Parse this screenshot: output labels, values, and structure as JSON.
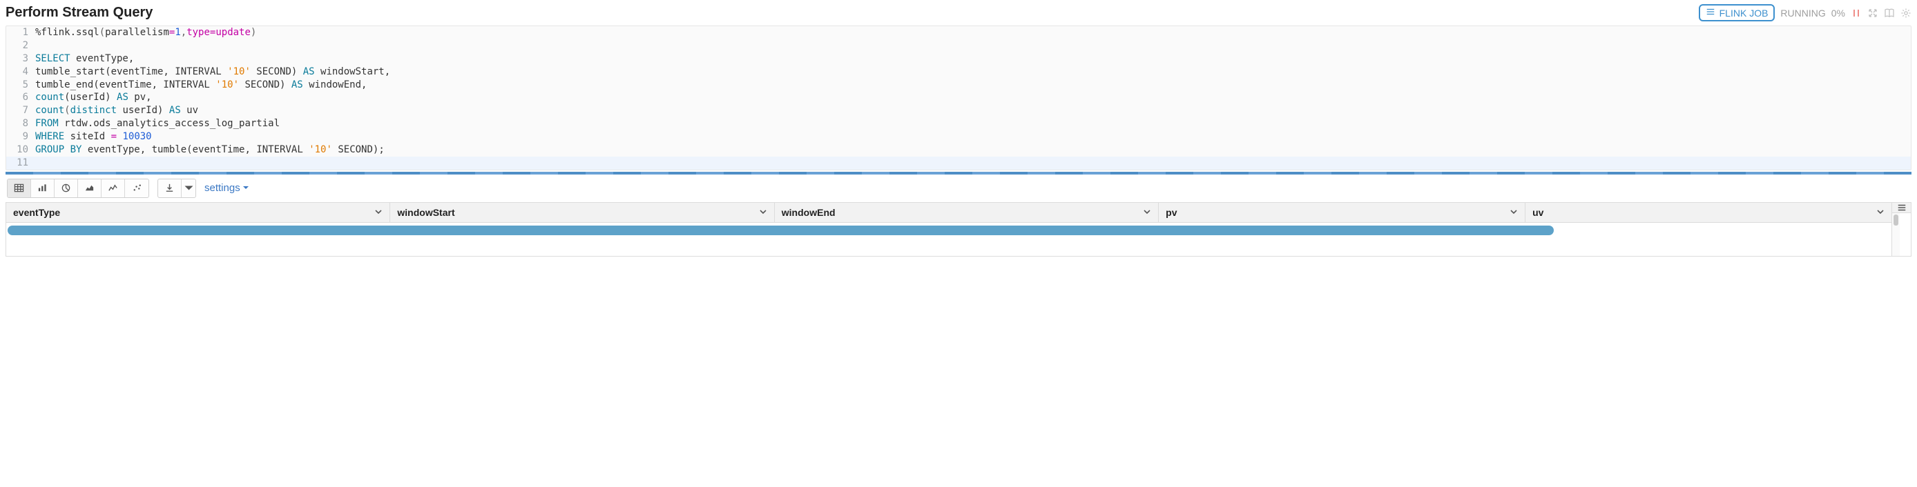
{
  "header": {
    "title": "Perform Stream Query",
    "flink_job_label": "FLINK JOB",
    "status": "RUNNING",
    "progress": "0%"
  },
  "code": {
    "lines": [
      {
        "n": "1",
        "tokens": [
          {
            "t": "%flink.ssql",
            "c": "tk-id"
          },
          {
            "t": "(",
            "c": "tk-punc"
          },
          {
            "t": "parallelism",
            "c": "tk-id"
          },
          {
            "t": "=",
            "c": "tk-op"
          },
          {
            "t": "1",
            "c": "tk-num"
          },
          {
            "t": ",",
            "c": "tk-punc"
          },
          {
            "t": "type",
            "c": "tk-type"
          },
          {
            "t": "=",
            "c": "tk-op"
          },
          {
            "t": "update",
            "c": "tk-type"
          },
          {
            "t": ")",
            "c": "tk-punc"
          }
        ]
      },
      {
        "n": "2",
        "tokens": []
      },
      {
        "n": "3",
        "tokens": [
          {
            "t": "SELECT",
            "c": "tk-key"
          },
          {
            "t": " eventType,",
            "c": "tk-id"
          }
        ]
      },
      {
        "n": "4",
        "tokens": [
          {
            "t": "tumble_start(eventTime, INTERVAL ",
            "c": "tk-id"
          },
          {
            "t": "'10'",
            "c": "tk-str"
          },
          {
            "t": " SECOND) ",
            "c": "tk-id"
          },
          {
            "t": "AS",
            "c": "tk-key"
          },
          {
            "t": " windowStart,",
            "c": "tk-id"
          }
        ]
      },
      {
        "n": "5",
        "tokens": [
          {
            "t": "tumble_end(eventTime, INTERVAL ",
            "c": "tk-id"
          },
          {
            "t": "'10'",
            "c": "tk-str"
          },
          {
            "t": " SECOND) ",
            "c": "tk-id"
          },
          {
            "t": "AS",
            "c": "tk-key"
          },
          {
            "t": " windowEnd,",
            "c": "tk-id"
          }
        ]
      },
      {
        "n": "6",
        "tokens": [
          {
            "t": "count",
            "c": "tk-key"
          },
          {
            "t": "(userId) ",
            "c": "tk-id"
          },
          {
            "t": "AS",
            "c": "tk-key"
          },
          {
            "t": " pv,",
            "c": "tk-id"
          }
        ]
      },
      {
        "n": "7",
        "tokens": [
          {
            "t": "count",
            "c": "tk-key"
          },
          {
            "t": "(",
            "c": "tk-punc"
          },
          {
            "t": "distinct",
            "c": "tk-key"
          },
          {
            "t": " userId) ",
            "c": "tk-id"
          },
          {
            "t": "AS",
            "c": "tk-key"
          },
          {
            "t": " uv",
            "c": "tk-id"
          }
        ]
      },
      {
        "n": "8",
        "tokens": [
          {
            "t": "FROM",
            "c": "tk-key"
          },
          {
            "t": " rtdw.ods_analytics_access_log_partial",
            "c": "tk-id"
          }
        ]
      },
      {
        "n": "9",
        "tokens": [
          {
            "t": "WHERE",
            "c": "tk-key"
          },
          {
            "t": " siteId ",
            "c": "tk-id"
          },
          {
            "t": "=",
            "c": "tk-op"
          },
          {
            "t": " ",
            "c": "tk-id"
          },
          {
            "t": "10030",
            "c": "tk-num"
          }
        ]
      },
      {
        "n": "10",
        "tokens": [
          {
            "t": "GROUP",
            "c": "tk-key"
          },
          {
            "t": " ",
            "c": "tk-id"
          },
          {
            "t": "BY",
            "c": "tk-key"
          },
          {
            "t": " eventType, tumble(eventTime, INTERVAL ",
            "c": "tk-id"
          },
          {
            "t": "'10'",
            "c": "tk-str"
          },
          {
            "t": " SECOND);",
            "c": "tk-id"
          }
        ]
      },
      {
        "n": "11",
        "tokens": [],
        "active": true
      }
    ]
  },
  "toolbar": {
    "settings_label": "settings"
  },
  "table": {
    "columns": [
      "eventType",
      "windowStart",
      "windowEnd",
      "pv",
      "uv"
    ]
  }
}
